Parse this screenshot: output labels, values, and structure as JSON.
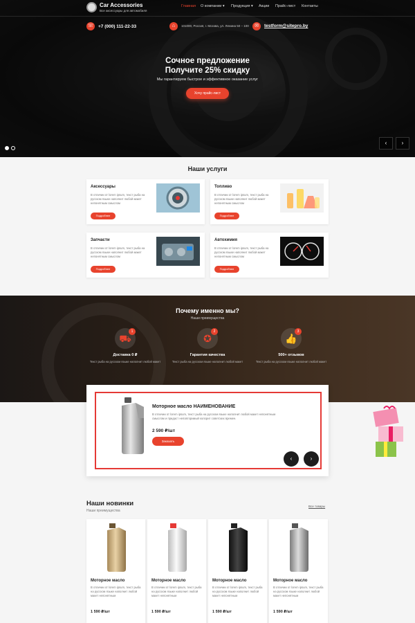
{
  "header": {
    "logo_title": "Car Accessories",
    "logo_subtitle": "Все аксессуары для автомобиля",
    "menu": [
      {
        "label": "Главная",
        "active": true
      },
      {
        "label": "О компании ▾",
        "active": false
      },
      {
        "label": "Продукция ▾",
        "active": false
      },
      {
        "label": "Акции",
        "active": false
      },
      {
        "label": "Прайс-лист",
        "active": false
      },
      {
        "label": "Контакты",
        "active": false
      }
    ],
    "phone": "+7 (000) 111-22-33",
    "address": "101000, Россия, г. Москва, ул. Ленина 50 – 100",
    "email": "testform@sitepro.by"
  },
  "hero": {
    "title_line1": "Сочное предложение",
    "title_line2": "Получите 25% скидку",
    "subtitle": "Мы гарантируем быстрое и эффективное оказание услуг",
    "button": "Хочу прайс-лист",
    "prev": "‹",
    "next": "›"
  },
  "services": {
    "title": "Наши услуги",
    "items": [
      {
        "title": "Аксессуары",
        "text": "В отличии от lorem ipsum, текст рыба на русском языке наполнит любой макет непонятным смыслом",
        "button": "Подробнее"
      },
      {
        "title": "Топливо",
        "text": "В отличии от lorem ipsum, текст рыба на русском языке наполнит любой макет непонятным смыслом",
        "button": "Подробнее"
      },
      {
        "title": "Запчасти",
        "text": "В отличии от lorem ipsum, текст рыба на русском языке наполнит любой макет непонятным смыслом",
        "button": "Подробнее"
      },
      {
        "title": "Автохимия",
        "text": "В отличии от lorem ipsum, текст рыба на русском языке наполнит любой макет непонятным смыслом",
        "button": "Подробнее"
      }
    ]
  },
  "why": {
    "title": "Почему именно мы?",
    "subtitle": "Наши преимущества",
    "items": [
      {
        "badge": "1",
        "title": "Доставка 0 ₽",
        "text": "Текст рыба на русском языке наполнит любой макет"
      },
      {
        "badge": "2",
        "title": "Гарантия качества",
        "text": "Текст рыба на русском языке наполнит любой макет"
      },
      {
        "badge": "3",
        "title": "500+ отзывов",
        "text": "Текст рыба на русском языке наполнит любой макет"
      }
    ]
  },
  "featured": {
    "name": "Моторное масло НАИМЕНОВАНИЕ",
    "description": "В отличии от lorem ipsum, текст рыба на русском языке наполнит любой макет непонятным смыслом и придаст неповторимый колорит советских времен.",
    "price": "2 590 ₽/шт",
    "button": "Заказать",
    "prev": "‹",
    "next": "›"
  },
  "new_products": {
    "title": "Наши новинки",
    "subtitle": "Наши преимущества",
    "all_link": "Все товары",
    "items": [
      {
        "name": "Моторное масло",
        "text": "В отличии от lorem ipsum, текст рыба на русском языке наполнит любой макет непонятным",
        "price": "1 590 ₽/шт"
      },
      {
        "name": "Моторное масло",
        "text": "В отличии от lorem ipsum, текст рыба на русском языке наполнит любой макет непонятным",
        "price": "1 590 ₽/шт"
      },
      {
        "name": "Моторное масло",
        "text": "В отличии от lorem ipsum, текст рыба на русском языке наполнит любой макет непонятным",
        "price": "1 590 ₽/шт"
      },
      {
        "name": "Моторное масло",
        "text": "В отличии от lorem ipsum, текст рыба на русском языке наполнит любой макет непонятным",
        "price": "1 590 ₽/шт"
      }
    ]
  },
  "colors": {
    "accent": "#e8432d",
    "highlight_frame": "#e53935"
  }
}
